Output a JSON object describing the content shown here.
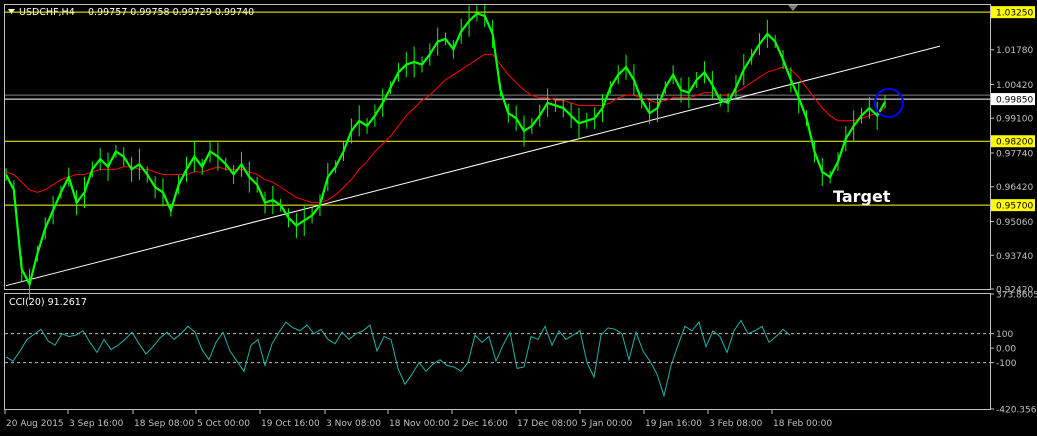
{
  "header": {
    "symbol_title": "USDCHF,H4",
    "ohlc": "0.99757 0.99758 0.99729 0.99740"
  },
  "annotation": {
    "target_label": "Target"
  },
  "indicator": {
    "title": "CCI(20) 91.2617"
  },
  "colors": {
    "background": "#000000",
    "price": "#00ff00",
    "ma": "#ff0000",
    "trendline": "#ffffff",
    "levels": "#ffff00",
    "cci": "#20b2aa",
    "circle": "#0000ff",
    "axis": "#c0c0c0",
    "hline_white": "#ffffff"
  },
  "chart_data": [
    {
      "type": "line",
      "title": "USDCHF,H4",
      "ylim": [
        0.9242,
        1.0353
      ],
      "y_ticks": [
        "1.03250",
        "1.01780",
        "1.00420",
        "0.99850",
        "0.99100",
        "0.98200",
        "0.97740",
        "0.96420",
        "0.95700",
        "0.95060",
        "0.93740",
        "0.92420"
      ],
      "x_ticks": [
        "20 Aug 2015",
        "3 Sep 16:00",
        "18 Sep 08:00",
        "5 Oct 00:00",
        "19 Oct 16:00",
        "3 Nov 08:00",
        "18 Nov 00:00",
        "2 Dec 16:00",
        "17 Dec 08:00",
        "5 Jan 00:00",
        "19 Jan 16:00",
        "3 Feb 08:00",
        "18 Feb 00:00"
      ],
      "horizontal_levels": [
        {
          "value": 1.0325,
          "label": "1.03250",
          "color": "yellow"
        },
        {
          "value": 0.9985,
          "label": "0.99850",
          "color": "white"
        },
        {
          "value": 0.982,
          "label": "0.98200",
          "color": "yellow"
        },
        {
          "value": 0.957,
          "label": "0.95700",
          "color": "yellow"
        }
      ],
      "series": [
        {
          "values": [
            0.969,
            0.963,
            0.932,
            0.926,
            0.938,
            0.948,
            0.955,
            0.962,
            0.968,
            0.958,
            0.962,
            0.971,
            0.975,
            0.972,
            0.978,
            0.976,
            0.971,
            0.973,
            0.969,
            0.964,
            0.962,
            0.955,
            0.965,
            0.971,
            0.976,
            0.972,
            0.978,
            0.976,
            0.973,
            0.969,
            0.973,
            0.968,
            0.965,
            0.958,
            0.959,
            0.957,
            0.952,
            0.949,
            0.951,
            0.953,
            0.957,
            0.968,
            0.972,
            0.978,
            0.986,
            0.99,
            0.988,
            0.992,
            0.997,
            1.003,
            1.009,
            1.012,
            1.013,
            1.012,
            1.016,
            1.021,
            1.022,
            1.018,
            1.025,
            1.029,
            1.032,
            1.031,
            1.024,
            1.002,
            0.993,
            0.991,
            0.986,
            0.988,
            0.992,
            0.997,
            0.996,
            0.995,
            0.992,
            0.989,
            0.99,
            0.991,
            0.995,
            1.003,
            1.008,
            1.011,
            1.006,
            0.998,
            0.993,
            0.995,
            1.003,
            1.008,
            1.002,
            1.001,
            1.006,
            1.009,
            1.004,
            0.998,
            0.997,
            1.003,
            1.01,
            1.015,
            1.02,
            1.024,
            1.021,
            1.014,
            1.006,
            0.999,
            0.991,
            0.978,
            0.97,
            0.968,
            0.974,
            0.983,
            0.988,
            0.992,
            0.995,
            0.992,
            0.9974
          ]
        },
        {
          "values": [
            0.97,
            0.969,
            0.966,
            0.963,
            0.962,
            0.963,
            0.965,
            0.967,
            0.968,
            0.969,
            0.969,
            0.97,
            0.971,
            0.971,
            0.971,
            0.972,
            0.972,
            0.971,
            0.971,
            0.97,
            0.969,
            0.969,
            0.969,
            0.969,
            0.97,
            0.97,
            0.971,
            0.972,
            0.971,
            0.971,
            0.971,
            0.97,
            0.969,
            0.967,
            0.966,
            0.964,
            0.962,
            0.96,
            0.959,
            0.958,
            0.958,
            0.959,
            0.961,
            0.964,
            0.967,
            0.971,
            0.974,
            0.978,
            0.981,
            0.984,
            0.988,
            0.992,
            0.995,
            0.998,
            1.0,
            1.003,
            1.006,
            1.008,
            1.01,
            1.012,
            1.014,
            1.016,
            1.016,
            1.012,
            1.008,
            1.005,
            1.002,
            1.0,
            0.999,
            0.999,
            0.998,
            0.998,
            0.997,
            0.996,
            0.996,
            0.996,
            0.996,
            0.997,
            0.999,
            1.0,
            1.0,
            0.999,
            0.998,
            0.997,
            0.998,
            0.999,
            0.999,
            0.999,
            1.0,
            1.001,
            1.001,
            1.0,
            1.0,
            1.001,
            1.003,
            1.005,
            1.007,
            1.009,
            1.01,
            1.011,
            1.01,
            1.007,
            1.003,
            0.999,
            0.995,
            0.992,
            0.99,
            0.99,
            0.99,
            0.991,
            0.992,
            0.993,
            0.995
          ]
        }
      ],
      "trendline": {
        "start": [
          0,
          0.9255
        ],
        "end": [
          119,
          1.0192
        ]
      },
      "circle_marker": {
        "x": 112.5,
        "y": 0.997
      }
    },
    {
      "type": "line",
      "title": "CCI(20) 91.2617",
      "ylim": [
        -420.3569,
        373.8605
      ],
      "y_ticks": [
        "373.8605",
        "100",
        "0.00",
        "-100",
        "-420.3569"
      ],
      "levels": [
        100,
        -100
      ],
      "series": [
        {
          "values": [
            -60,
            -90,
            -20,
            60,
            95,
            130,
            50,
            20,
            100,
            80,
            90,
            120,
            40,
            -30,
            60,
            -10,
            20,
            60,
            110,
            30,
            -40,
            10,
            70,
            110,
            60,
            100,
            150,
            110,
            -10,
            -80,
            40,
            110,
            -20,
            -90,
            -160,
            20,
            60,
            -120,
            30,
            110,
            180,
            140,
            120,
            160,
            100,
            130,
            60,
            30,
            110,
            60,
            100,
            120,
            160,
            -20,
            80,
            60,
            -140,
            -250,
            -180,
            -100,
            -160,
            -110,
            -80,
            -120,
            -130,
            -160,
            -100,
            90,
            40,
            80,
            -90,
            20,
            110,
            -140,
            -130,
            80,
            60,
            150,
            20,
            120,
            60,
            90,
            120,
            -100,
            -200,
            90,
            140,
            130,
            100,
            -80,
            110,
            -20,
            -90,
            -180,
            -330,
            -120,
            20,
            150,
            120,
            180,
            10,
            120,
            80,
            -30,
            120,
            191,
            100,
            120,
            150,
            40,
            80,
            130,
            91
          ]
        }
      ]
    }
  ]
}
